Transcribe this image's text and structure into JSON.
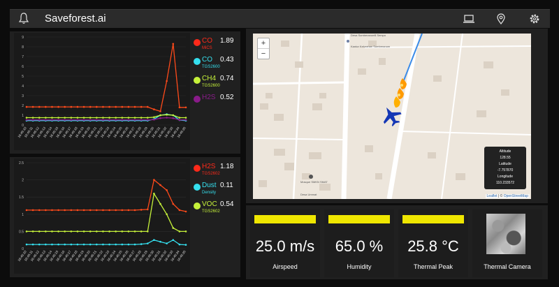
{
  "app": {
    "title": "Saveforest.ai"
  },
  "icons": {
    "notifications": "bell-icon",
    "device": "laptop-icon",
    "location": "map-pin-icon",
    "settings": "gear-icon"
  },
  "charts": [
    {
      "legend": [
        {
          "name": "CO",
          "sensor": "MiCS",
          "value": "1.89",
          "color": "#ff2a1a",
          "label_color": "#ff2a1a"
        },
        {
          "name": "CO",
          "sensor": "TGS2600",
          "value": "0.43",
          "color": "#35e0ef",
          "label_color": "#35e0ef"
        },
        {
          "name": "CH4",
          "sensor": "TGS2600",
          "value": "0.74",
          "color": "#c6f23a",
          "label_color": "#c6f23a"
        },
        {
          "name": "H2S",
          "sensor": "",
          "value": "0.52",
          "color": "#8a1b8a",
          "label_color": "#8a1b8a"
        }
      ]
    },
    {
      "legend": [
        {
          "name": "H2S",
          "sensor": "TGS2602",
          "value": "1.18",
          "color": "#ff2a1a",
          "label_color": "#ff2a1a"
        },
        {
          "name": "Dust",
          "sensor": "Density",
          "value": "0.11",
          "color": "#35e0ef",
          "label_color": "#35e0ef"
        },
        {
          "name": "VOC",
          "sensor": "TGS2602",
          "value": "0.54",
          "color": "#c6f23a",
          "label_color": "#c6f23a"
        }
      ]
    }
  ],
  "chart_data": [
    {
      "type": "line",
      "x": [
        "16:45:10",
        "16:45:11",
        "16:45:12",
        "16:45:13",
        "16:45:14",
        "16:45:15",
        "16:45:16",
        "16:45:17",
        "16:45:18",
        "16:45:19",
        "16:45:20",
        "16:45:21",
        "16:45:22",
        "16:45:23",
        "16:45:24",
        "16:45:25",
        "16:45:26",
        "16:45:27",
        "16:45:28",
        "16:45:29",
        "16:45:30",
        "16:45:31",
        "16:45:32",
        "16:45:33",
        "16:45:34",
        "16:45:35"
      ],
      "ylim": [
        0,
        9
      ],
      "yticks": [
        0,
        1,
        2,
        3,
        4,
        5,
        6,
        7,
        8,
        9
      ],
      "series": [
        {
          "name": "CO MiCS",
          "color": "#ff4a1a",
          "values": [
            1.85,
            1.85,
            1.85,
            1.85,
            1.85,
            1.85,
            1.85,
            1.85,
            1.85,
            1.85,
            1.85,
            1.85,
            1.85,
            1.85,
            1.85,
            1.85,
            1.85,
            1.85,
            1.85,
            1.85,
            1.6,
            1.4,
            4.5,
            8.3,
            1.8,
            1.8
          ]
        },
        {
          "name": "CO TGS2600",
          "color": "#35e0ef",
          "values": [
            0.45,
            0.45,
            0.45,
            0.45,
            0.45,
            0.45,
            0.45,
            0.45,
            0.45,
            0.45,
            0.45,
            0.45,
            0.45,
            0.45,
            0.45,
            0.45,
            0.45,
            0.45,
            0.45,
            0.45,
            0.6,
            1.0,
            1.1,
            1.0,
            0.5,
            0.45
          ]
        },
        {
          "name": "CH4 TGS2600",
          "color": "#c6f23a",
          "values": [
            0.75,
            0.75,
            0.75,
            0.75,
            0.75,
            0.75,
            0.75,
            0.75,
            0.75,
            0.75,
            0.75,
            0.75,
            0.75,
            0.75,
            0.75,
            0.75,
            0.75,
            0.75,
            0.75,
            0.75,
            0.8,
            1.0,
            1.05,
            1.0,
            0.75,
            0.75
          ]
        },
        {
          "name": "H2S",
          "color": "#8a1b8a",
          "values": [
            0.52,
            0.52,
            0.52,
            0.52,
            0.52,
            0.52,
            0.52,
            0.52,
            0.52,
            0.52,
            0.52,
            0.52,
            0.52,
            0.52,
            0.52,
            0.52,
            0.52,
            0.52,
            0.52,
            0.52,
            0.55,
            0.7,
            0.75,
            0.7,
            0.52,
            0.52
          ]
        }
      ]
    },
    {
      "type": "line",
      "x": [
        "16:45:10",
        "16:45:11",
        "16:45:12",
        "16:45:13",
        "16:45:14",
        "16:45:15",
        "16:45:16",
        "16:45:17",
        "16:45:18",
        "16:45:19",
        "16:45:20",
        "16:45:21",
        "16:45:22",
        "16:45:23",
        "16:45:24",
        "16:45:25",
        "16:45:26",
        "16:45:27",
        "16:45:28",
        "16:45:29",
        "16:45:30",
        "16:45:31",
        "16:45:32",
        "16:45:33",
        "16:45:34",
        "16:45:35"
      ],
      "ylim": [
        0,
        2.5
      ],
      "yticks": [
        0,
        0.5,
        1,
        1.5,
        2,
        2.5
      ],
      "series": [
        {
          "name": "H2S TGS2602",
          "color": "#ff4a1a",
          "values": [
            1.12,
            1.12,
            1.12,
            1.12,
            1.12,
            1.12,
            1.12,
            1.12,
            1.12,
            1.12,
            1.12,
            1.12,
            1.12,
            1.12,
            1.12,
            1.12,
            1.12,
            1.12,
            1.13,
            1.14,
            2.0,
            1.85,
            1.7,
            1.3,
            1.12,
            1.08
          ]
        },
        {
          "name": "Dust Density",
          "color": "#35e0ef",
          "values": [
            0.12,
            0.12,
            0.12,
            0.12,
            0.12,
            0.12,
            0.12,
            0.12,
            0.12,
            0.12,
            0.12,
            0.12,
            0.12,
            0.12,
            0.12,
            0.12,
            0.12,
            0.12,
            0.13,
            0.15,
            0.25,
            0.2,
            0.15,
            0.25,
            0.12,
            0.11
          ]
        },
        {
          "name": "VOC TGS2602",
          "color": "#c6f23a",
          "values": [
            0.5,
            0.5,
            0.5,
            0.5,
            0.5,
            0.5,
            0.5,
            0.5,
            0.5,
            0.5,
            0.5,
            0.5,
            0.5,
            0.5,
            0.5,
            0.5,
            0.5,
            0.5,
            0.5,
            0.5,
            1.6,
            1.3,
            1.0,
            0.6,
            0.5,
            0.5
          ]
        }
      ]
    }
  ],
  "map": {
    "zoom_in": "+",
    "zoom_out": "−",
    "place_top": "Desa Sumberanom",
    "place_right": "5 Sempu",
    "place_mid": "Kantor Kelurahan Sumberanom",
    "place_school": "Mosque SMKN SMAT",
    "place_bottom": "Desa Ummat",
    "info": {
      "altitude_label": "Altitude",
      "altitude_value": "128.55",
      "latitude_label": "Latitude",
      "latitude_value": "-7.757870",
      "longitude_label": "Longitude",
      "longitude_value": "110.233572"
    },
    "attribution_leaflet": "Leaflet",
    "attribution_sep": " | © ",
    "attribution_osm": "OpenStreetMap"
  },
  "tiles": [
    {
      "value": "25.0 m/s",
      "label": "Airspeed"
    },
    {
      "value": "65.0 %",
      "label": "Humidity"
    },
    {
      "value": "25.8 °C",
      "label": "Thermal Peak"
    },
    {
      "value": "",
      "label": "Thermal Camera"
    }
  ]
}
